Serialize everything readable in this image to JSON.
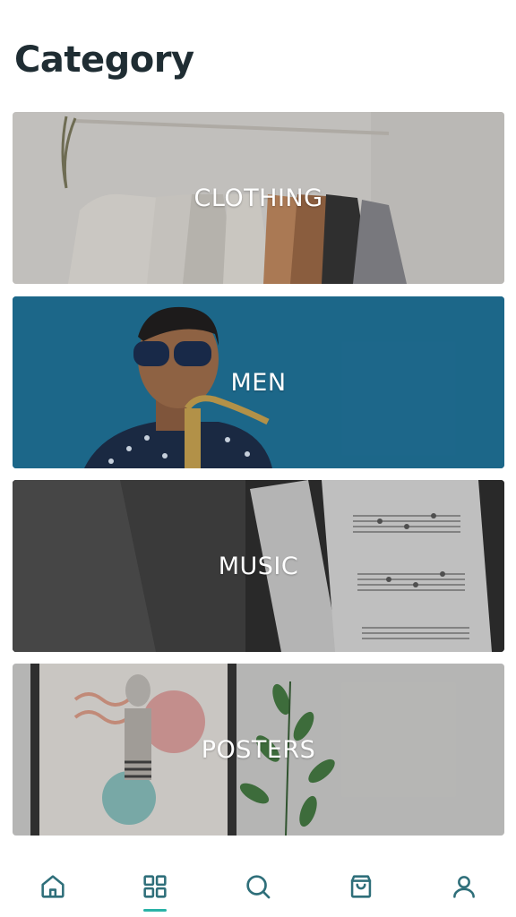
{
  "header": {
    "title": "Category"
  },
  "categories": [
    {
      "label": "CLOTHING"
    },
    {
      "label": "MEN"
    },
    {
      "label": "MUSIC"
    },
    {
      "label": "POSTERS"
    }
  ],
  "bottom_nav": {
    "items": [
      {
        "icon": "home-icon"
      },
      {
        "icon": "grid-icon",
        "active": true
      },
      {
        "icon": "search-icon"
      },
      {
        "icon": "shopping-bag-icon"
      },
      {
        "icon": "user-icon"
      }
    ]
  },
  "colors": {
    "title": "#1f2d33",
    "icon": "#2f6f7a",
    "accent": "#2bb3a7",
    "men_bg": "#1d6f93"
  }
}
